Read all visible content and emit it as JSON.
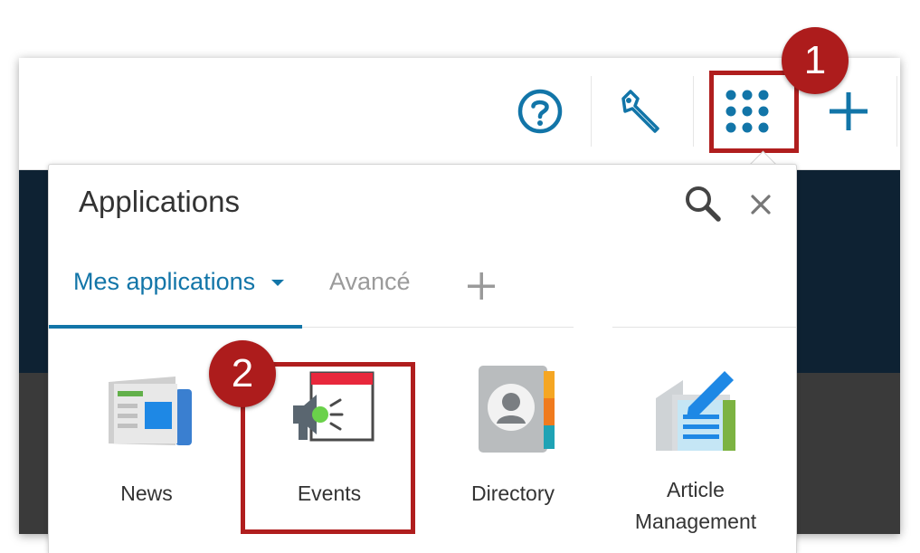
{
  "topbar": {
    "buttons": [
      {
        "name": "help",
        "icon": "help-circle-icon"
      },
      {
        "name": "tools",
        "icon": "wrench-icon"
      },
      {
        "name": "apps",
        "icon": "grid-icon"
      },
      {
        "name": "add",
        "icon": "plus-icon"
      }
    ]
  },
  "callouts": [
    {
      "number": "1"
    },
    {
      "number": "2"
    }
  ],
  "panel": {
    "title": "Applications",
    "tabs": [
      {
        "label": "Mes applications",
        "active": true
      },
      {
        "label": "Avancé",
        "active": false
      }
    ],
    "apps": [
      {
        "label": "News",
        "icon": "news-icon"
      },
      {
        "label": "Events",
        "icon": "events-icon"
      },
      {
        "label": "Directory",
        "icon": "directory-icon"
      },
      {
        "label": "Article Management",
        "icon": "article-management-icon"
      }
    ]
  },
  "colors": {
    "accent": "#1275a8",
    "callout": "#ad1c1c",
    "navy": "#0e2233"
  }
}
